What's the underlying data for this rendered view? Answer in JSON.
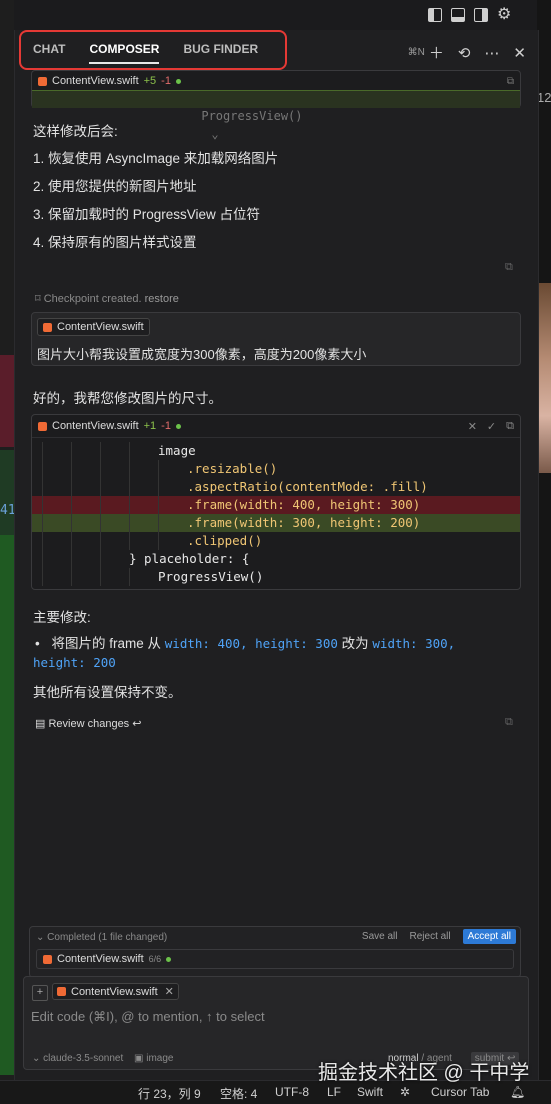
{
  "window_controls": {
    "icons": [
      "sidebar-left-icon",
      "panel-bottom-icon",
      "sidebar-right-icon",
      "gear-icon"
    ]
  },
  "editor_edge": {
    "left_line_number": "41",
    "right_line_number": "12"
  },
  "tabs": [
    {
      "label": "CHAT",
      "active": false
    },
    {
      "label": "COMPOSER",
      "active": true
    },
    {
      "label": "BUG FINDER",
      "active": false
    }
  ],
  "panel_actions": {
    "shortcut": "⌘N"
  },
  "first_block": {
    "file": "ContentView.swift",
    "added": "+5",
    "removed": "-1",
    "code_line": "ProgressView()"
  },
  "assistant_1": {
    "intro": "这样修改后会:",
    "items": [
      "1. 恢复使用 AsyncImage 来加载网络图片",
      "2. 使用您提供的新图片地址",
      "3. 保留加载时的 ProgressView 占位符",
      "4. 保持原有的图片样式设置"
    ]
  },
  "checkpoint": {
    "text": "Checkpoint created.",
    "restore": "restore"
  },
  "user_message": {
    "file_chip": "ContentView.swift",
    "text": "图片大小帮我设置成宽度为300像素，高度为200像素大小"
  },
  "assistant_2": {
    "reply": "好的，我帮您修改图片的尺寸。",
    "code": {
      "file": "ContentView.swift",
      "added": "+1",
      "removed": "-1",
      "lines": [
        {
          "text": "image",
          "state": "normal",
          "indent": 4
        },
        {
          "text": ".resizable()",
          "state": "normal",
          "indent": 5
        },
        {
          "text": ".aspectRatio(contentMode: .fill)",
          "state": "normal",
          "indent": 5
        },
        {
          "text": ".frame(width: 400, height: 300)",
          "state": "removed",
          "indent": 5
        },
        {
          "text": ".frame(width: 300, height: 200)",
          "state": "added",
          "indent": 5
        },
        {
          "text": ".clipped()",
          "state": "normal",
          "indent": 5
        },
        {
          "text": "} placeholder: {",
          "state": "normal",
          "indent": 3
        },
        {
          "text": "ProgressView()",
          "state": "normal",
          "indent": 4
        }
      ]
    },
    "summary_title": "主要修改:",
    "bullet_prefix": "将图片的 frame 从",
    "bullet_from": "width: 400, height: 300",
    "bullet_mid": "改为",
    "bullet_to": "width: 300,",
    "bullet_to2": "height: 200",
    "footer": "其他所有设置保持不变。",
    "review": "Review changes ↩"
  },
  "completed_bar": {
    "status": "Completed (1 file changed)",
    "save_all": "Save all",
    "reject_all": "Reject all",
    "accept_all": "Accept all",
    "file": "ContentView.swift",
    "progress": "6/6"
  },
  "composer": {
    "file_chip": "ContentView.swift",
    "placeholder": "Edit code (⌘I), @ to mention, ↑ to select",
    "model": "claude-3.5-sonnet",
    "image_label": "image",
    "mode_normal": "normal",
    "mode_agent": "agent",
    "submit": "submit ↩"
  },
  "status_bar": {
    "position": "行 23，列 9",
    "spaces": "空格: 4",
    "encoding": "UTF-8",
    "eol": "LF",
    "language": "Swift",
    "cursor_tab": "Cursor Tab"
  },
  "watermark": "掘金技术社区 @ 干中学"
}
